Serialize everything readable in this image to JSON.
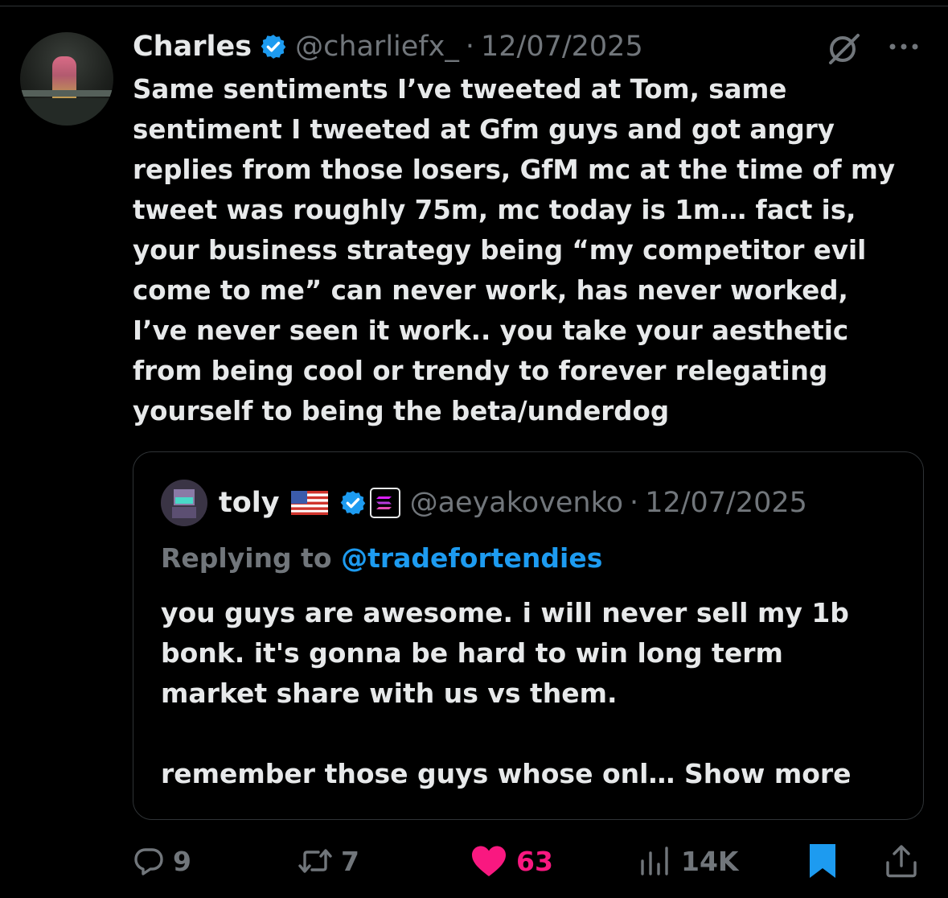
{
  "tweet": {
    "author_name": "Charles",
    "handle": "@charliefx_",
    "separator": "·",
    "date": "12/07/2025",
    "text_lines": [
      "Same sentiments I’ve tweeted at Tom, same",
      "sentiment I tweeted at Gfm guys and got angry",
      "replies from those losers, GfM mc at the time of my",
      "tweet was roughly 75m, mc today is 1m… fact is,",
      "your business strategy being “my competitor evil",
      "come to me” can never work, has never worked,",
      "I’ve never seen it work.. you take your aesthetic",
      "from being cool or trendy to forever relegating",
      "yourself to being the beta/underdog"
    ]
  },
  "quote": {
    "author_name": "toly",
    "handle": "@aeyakovenko",
    "separator": "·",
    "date": "12/07/2025",
    "replying_label": "Replying to",
    "replying_mention": "@tradefortendies",
    "text_lines": [
      "you guys are awesome.  i will never sell my 1b",
      "bonk.  it's gonna be hard to win long term",
      "market share with us vs them.",
      "",
      "remember those guys whose onl…"
    ],
    "show_more_label": "Show more"
  },
  "actions": {
    "replies": "9",
    "reposts": "7",
    "likes": "63",
    "views": "14K"
  },
  "colors": {
    "background": "#000000",
    "text": "#e7e9ea",
    "muted": "#71767b",
    "accent_blue": "#1d9bf0",
    "like_pink": "#f91880"
  },
  "icons": {
    "verified": "verified-badge-icon",
    "grok": "grok-icon",
    "more": "more-dots-icon",
    "flag": "us-flag-icon",
    "solana": "solana-logo-icon",
    "reply": "reply-icon",
    "repost": "repost-icon",
    "like": "heart-icon",
    "views": "views-icon",
    "bookmark": "bookmark-icon",
    "share": "share-icon"
  }
}
